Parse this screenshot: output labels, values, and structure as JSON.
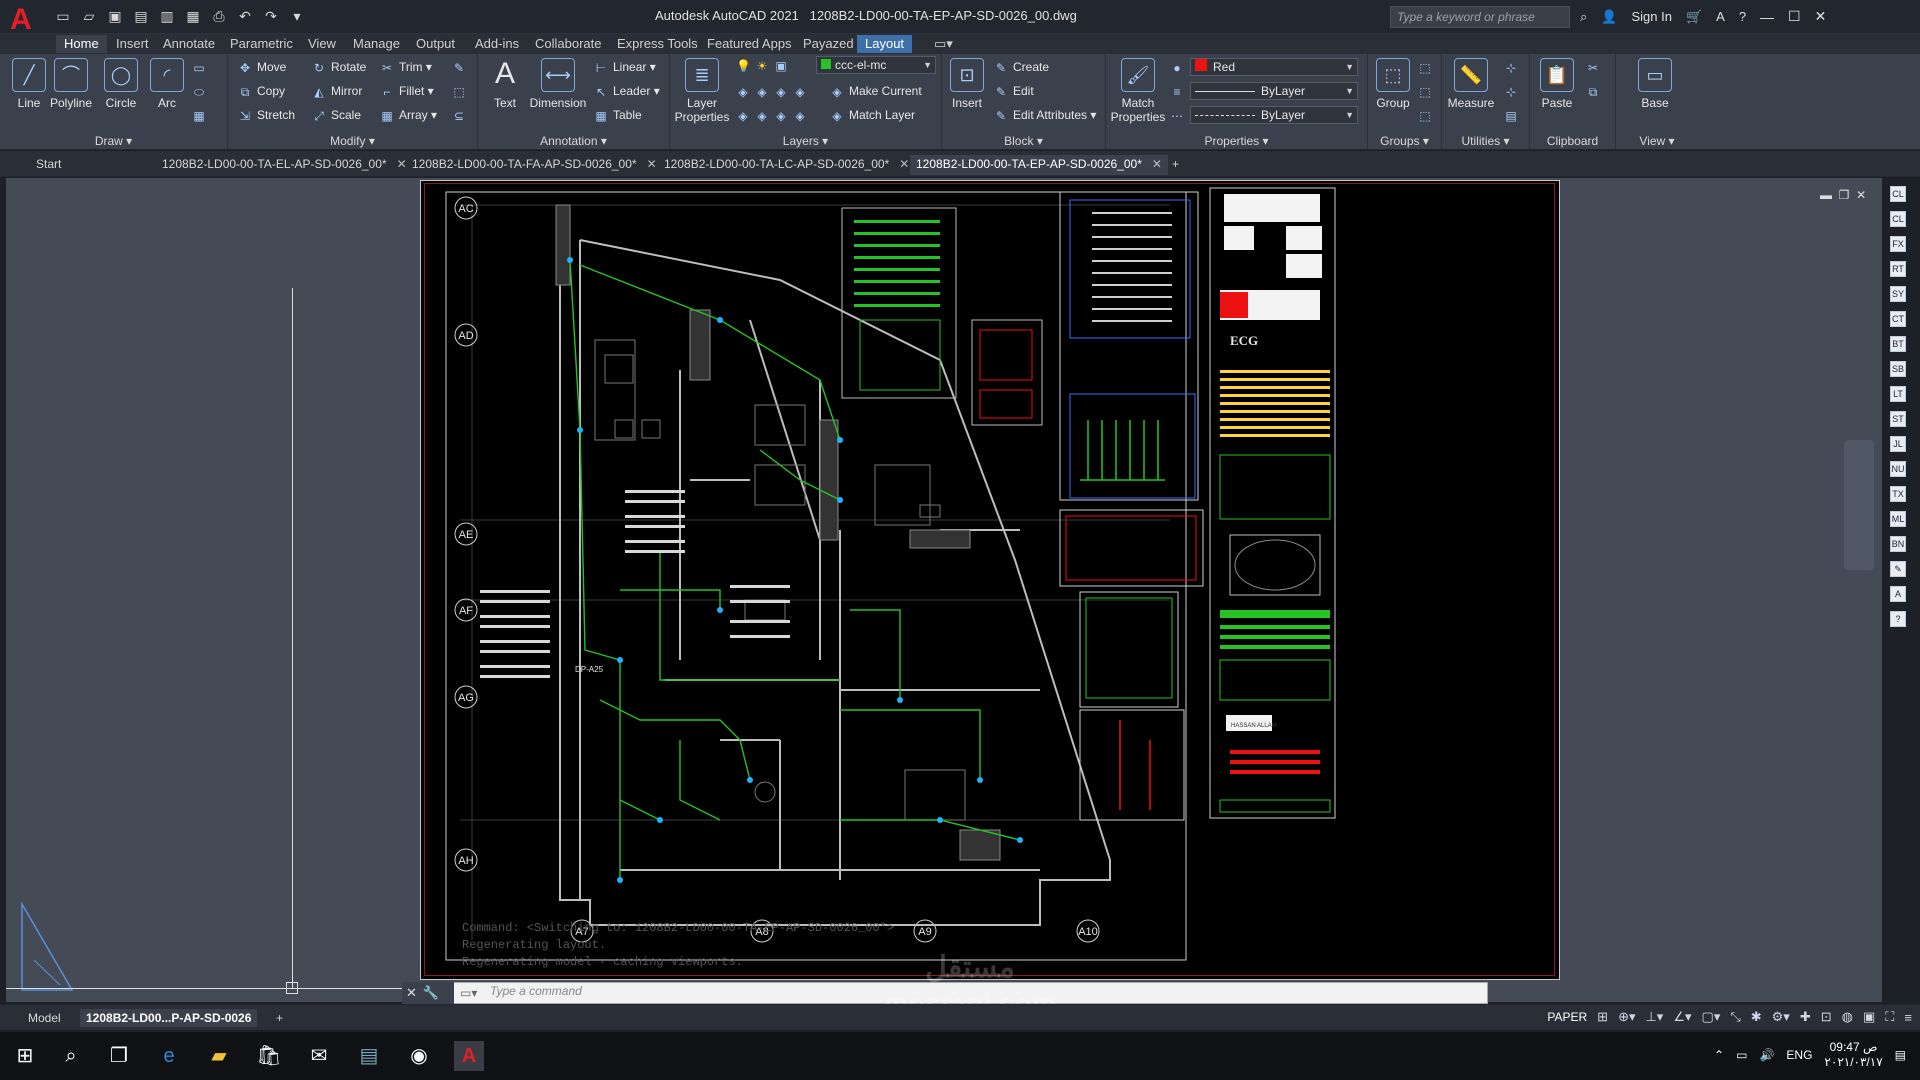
{
  "titlebar": {
    "app_name": "Autodesk AutoCAD 2021",
    "file_name": "1208B2-LD00-00-TA-EP-AP-SD-0026_00.dwg",
    "search_placeholder": "Type a keyword or phrase",
    "sign_in": "Sign In"
  },
  "ribbon_tabs": [
    "Home",
    "Insert",
    "Annotate",
    "Parametric",
    "View",
    "Manage",
    "Output",
    "Add-ins",
    "Collaborate",
    "Express Tools",
    "Featured Apps",
    "Payazed",
    "Layout"
  ],
  "ribbon": {
    "draw": {
      "label": "Draw",
      "tools": [
        "Line",
        "Polyline",
        "Circle",
        "Arc"
      ]
    },
    "modify": {
      "label": "Modify",
      "tools": [
        "Move",
        "Rotate",
        "Trim",
        "Copy",
        "Mirror",
        "Fillet",
        "Stretch",
        "Scale",
        "Array"
      ]
    },
    "annotation": {
      "label": "Annotation",
      "tools": [
        "Text",
        "Dimension",
        "Linear",
        "Leader",
        "Table"
      ]
    },
    "layers": {
      "label": "Layers",
      "big_tool": "Layer Properties",
      "current_layer": "ccc-el-mc",
      "tools": [
        "Make Current",
        "Match Layer"
      ]
    },
    "block": {
      "label": "Block",
      "big_tool": "Insert",
      "tools": [
        "Create",
        "Edit",
        "Edit Attributes"
      ]
    },
    "properties": {
      "label": "Properties",
      "big_tool": "Match Properties",
      "color": "Red",
      "linetype": "ByLayer",
      "lineweight": "ByLayer"
    },
    "groups": {
      "label": "Groups",
      "big_tool": "Group"
    },
    "utilities": {
      "label": "Utilities",
      "big_tool": "Measure"
    },
    "clipboard": {
      "label": "Clipboard",
      "big_tool": "Paste"
    },
    "view": {
      "label": "View",
      "big_tool": "Base"
    }
  },
  "file_tabs": [
    {
      "label": "Start"
    },
    {
      "label": "1208B2-LD00-00-TA-EL-AP-SD-0026_00*"
    },
    {
      "label": "1208B2-LD00-00-TA-FA-AP-SD-0026_00*"
    },
    {
      "label": "1208B2-LD00-00-TA-LC-AP-SD-0026_00*"
    },
    {
      "label": "1208B2-LD00-00-TA-EP-AP-SD-0026_00*"
    }
  ],
  "drawing": {
    "grid_labels_left": [
      "AC",
      "AD",
      "AE",
      "AF",
      "AG",
      "AH"
    ],
    "grid_labels_bottom": [
      "A7",
      "A8",
      "A9",
      "A10"
    ],
    "panel_code": "DP-A25",
    "title_block_firm": "ECG",
    "title_block_contractor": "HASSAN ALLAM"
  },
  "command": {
    "history": [
      "Command:  <Switching to: 1208B2-LD00-00-TA-EP-AP-SD-0026_00*>",
      "Regenerating layout.",
      "Regenerating model - caching viewports."
    ],
    "placeholder": "Type a command"
  },
  "status": {
    "model_tab": "Model",
    "layout_tab": "1208B2-LD00...P-AP-SD-0026",
    "space": "PAPER"
  },
  "taskbar": {
    "lang": "ENG",
    "time": "09:47 ص",
    "date": "٢٠٢١/٠٣/١٧"
  },
  "watermark": {
    "line1": "مستقل",
    "line2": "mostaql.com"
  },
  "colors": {
    "accent": "#3d6fa8",
    "ribbon": "#3b414c",
    "canvas": "#454b56",
    "sheet": "#000000"
  }
}
